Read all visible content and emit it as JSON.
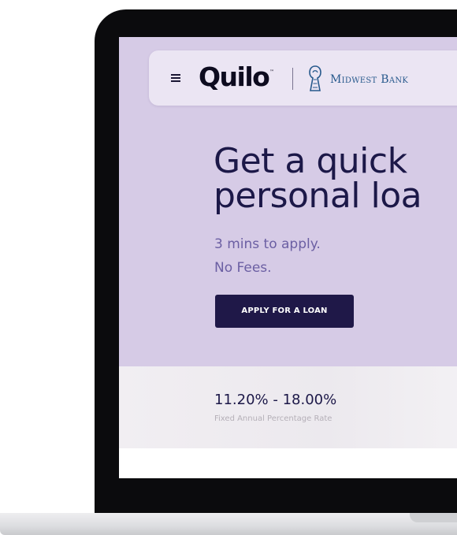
{
  "navbar": {
    "brand": "Quilo",
    "trademark": "™",
    "partner": "Midwest Bank",
    "icons": {
      "menu": "hamburger-menu-icon",
      "partner_emblem": "midwest-bank-emblem-icon"
    }
  },
  "hero": {
    "headline_line1": "Get a quick",
    "headline_line2": "personal loa",
    "subtitle_line1": "3 mins to apply.",
    "subtitle_line2": "No Fees.",
    "cta_label": "APPLY FOR A LOAN"
  },
  "rates": {
    "range": "11.20% - 18.00%",
    "caption": "Fixed Annual Percentage Rate"
  },
  "colors": {
    "hero_background": "#d6cbe6",
    "navbar_background": "#ebe5f3",
    "headline": "#1c1848",
    "subtitle": "#6b5fa3",
    "cta_background": "#1f1848",
    "bank_text": "#27598c",
    "bezel": "#0b0b0d"
  }
}
